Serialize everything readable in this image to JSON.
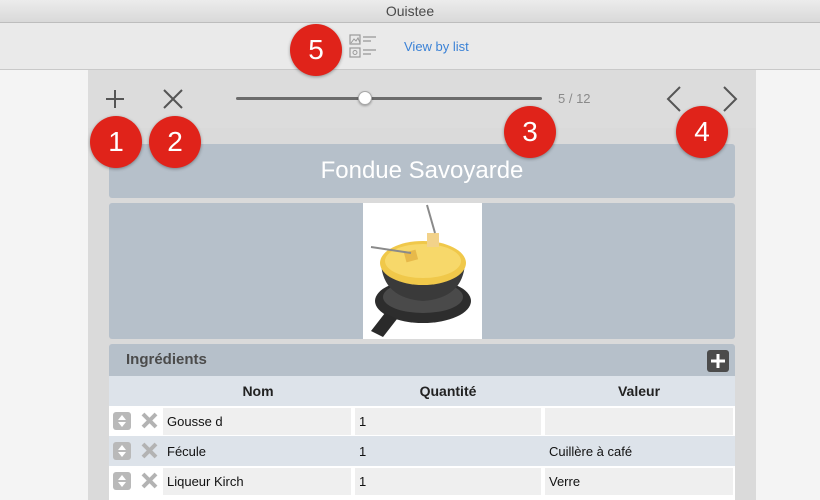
{
  "window": {
    "title": "Ouistee"
  },
  "toolbar": {
    "view_by_list_label": "View by list",
    "view_icon": "image-list-icon"
  },
  "nav": {
    "counter": "5 / 12",
    "slider_fraction": 0.42
  },
  "recipe": {
    "title": "Fondue Savoyarde",
    "image_alt": "fondue-pot-photo"
  },
  "ingredients": {
    "title": "Ingrédients",
    "columns": [
      "Nom",
      "Quantité",
      "Valeur"
    ],
    "rows": [
      {
        "nom": "Gousse d",
        "quantite": "1",
        "valeur": ""
      },
      {
        "nom": "Fécule",
        "quantite": "1",
        "valeur": "Cuillère à café"
      },
      {
        "nom": "Liqueur Kirch",
        "quantite": "1",
        "valeur": "Verre"
      }
    ]
  },
  "badges": [
    "1",
    "2",
    "3",
    "4",
    "5"
  ],
  "colors": {
    "badge": "#e0231a",
    "link": "#3b82d6",
    "panel": "#b6c0ca"
  }
}
